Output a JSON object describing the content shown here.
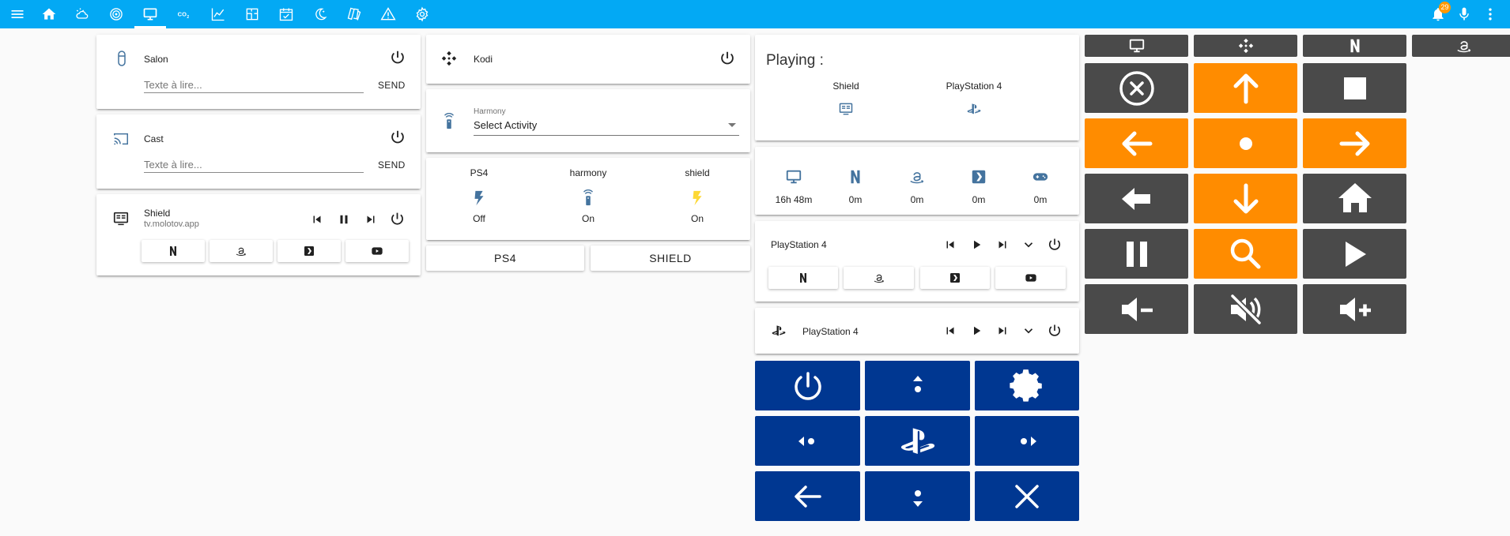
{
  "topbar": {
    "notification_count": "29",
    "icons": [
      "menu-icon",
      "home-icon",
      "weather-icon",
      "radar-icon",
      "tv-icon",
      "co2-icon",
      "chart-icon",
      "floorplan-icon",
      "calendar-icon",
      "moon-icon",
      "cards-icon",
      "alert-icon",
      "settings-icon",
      "bell-icon",
      "microphone-icon",
      "more-icon"
    ]
  },
  "tts_cards": [
    {
      "name": "Salon",
      "placeholder": "Texte à lire...",
      "send": "SEND"
    },
    {
      "name": "Cast",
      "placeholder": "Texte à lire...",
      "send": "SEND"
    }
  ],
  "shield_player": {
    "name": "Shield",
    "subtitle": "tv.molotov.app"
  },
  "kodi": {
    "name": "Kodi"
  },
  "harmony": {
    "label": "Harmony",
    "value": "Select Activity"
  },
  "glance": [
    {
      "name": "PS4",
      "state": "Off"
    },
    {
      "name": "harmony",
      "state": "On"
    },
    {
      "name": "shield",
      "state": "On"
    }
  ],
  "buttons": {
    "ps4": "PS4",
    "shield": "SHIELD"
  },
  "playing": {
    "title": "Playing :",
    "devices": [
      {
        "name": "Shield"
      },
      {
        "name": "PlayStation 4"
      }
    ]
  },
  "usage": [
    {
      "icon": "tv-icon",
      "value": "16h 48m"
    },
    {
      "icon": "netflix-icon",
      "value": "0m"
    },
    {
      "icon": "amazon-icon",
      "value": "0m"
    },
    {
      "icon": "plex-icon",
      "value": "0m"
    },
    {
      "icon": "gamepad-icon",
      "value": "0m"
    }
  ],
  "ps4_player_1": {
    "name": "PlayStation 4"
  },
  "ps4_player_2": {
    "name": "PlayStation 4"
  },
  "colors": {
    "topbar": "#03a9f4",
    "remote_dark": "#4a4a4a",
    "remote_orange": "#ff8c00",
    "ps_blue": "#003791",
    "bolt_blue": "#44739e",
    "bolt_yellow": "#fdd835"
  }
}
